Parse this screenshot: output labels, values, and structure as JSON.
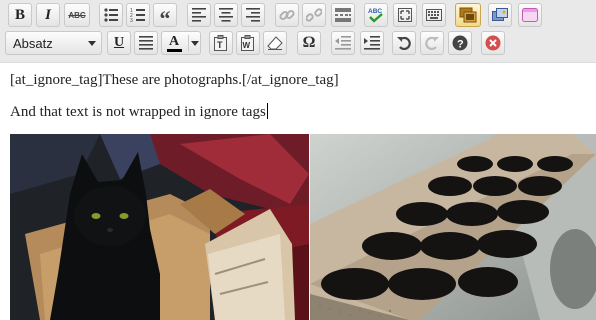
{
  "toolbar": {
    "format_select": {
      "value": "Absatz",
      "options": [
        "Absatz"
      ]
    },
    "row1_buttons": [
      "bold-button",
      "italic-button",
      "strikethrough-button",
      "bullet-list-button",
      "numbered-list-button",
      "blockquote-button",
      "align-left-button",
      "align-center-button",
      "align-right-button",
      "insert-link-button",
      "remove-link-button",
      "insert-more-button",
      "spellcheck-button",
      "fullscreen-button",
      "kitchen-sink-button",
      "ignore-tags-button",
      "add-media-button",
      "plugin-button"
    ],
    "row2_buttons": [
      "underline-button",
      "justify-button",
      "text-color-button",
      "paste-text-button",
      "paste-word-button",
      "clear-formatting-button",
      "special-chars-button",
      "outdent-button",
      "indent-button",
      "undo-button",
      "redo-button",
      "help-button",
      "remove-button"
    ],
    "labels": {
      "bold": "B",
      "italic": "I",
      "strike": "ABC",
      "quote": "“",
      "underline": "U",
      "omega": "Ω",
      "text_color": "A"
    }
  },
  "editor": {
    "paragraph1": "[at_ignore_tag]These are photographs.[/at_ignore_tag]",
    "paragraph2": "And that text is not wrapped in ignore tags"
  },
  "images": [
    {
      "name": "black-cat-in-box-photo"
    },
    {
      "name": "muffin-tray-photo"
    }
  ],
  "colors": {
    "toolbar_bg": "#e9e9e9",
    "button_border": "#c9c9c9",
    "remove_button_red": "#d54e4e"
  }
}
